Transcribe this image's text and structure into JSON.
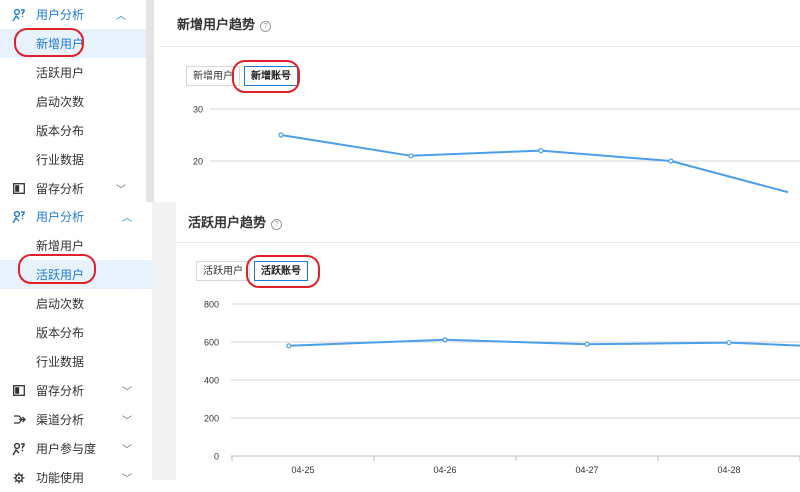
{
  "sidebar_top": {
    "group": {
      "label": "用户分析",
      "icon": "user-analysis-icon",
      "expanded": true
    },
    "items": [
      {
        "label": "新增用户",
        "selected": true
      },
      {
        "label": "活跃用户",
        "selected": false
      },
      {
        "label": "启动次数",
        "selected": false
      },
      {
        "label": "版本分布",
        "selected": false
      },
      {
        "label": "行业数据",
        "selected": false
      }
    ],
    "group2": {
      "label": "留存分析",
      "icon": "retention-icon"
    }
  },
  "sidebar_bottom": {
    "group": {
      "label": "用户分析",
      "icon": "user-analysis-icon",
      "expanded": true
    },
    "items": [
      {
        "label": "新增用户",
        "selected": false
      },
      {
        "label": "活跃用户",
        "selected": true
      },
      {
        "label": "启动次数",
        "selected": false
      },
      {
        "label": "版本分布",
        "selected": false
      },
      {
        "label": "行业数据",
        "selected": false
      }
    ],
    "groups": [
      {
        "label": "留存分析",
        "icon": "retention-icon"
      },
      {
        "label": "渠道分析",
        "icon": "channel-icon"
      },
      {
        "label": "用户参与度",
        "icon": "engagement-icon"
      },
      {
        "label": "功能使用",
        "icon": "feature-icon"
      }
    ]
  },
  "top_panel": {
    "title": "新增用户趋势",
    "tabs": [
      {
        "label": "新增用户",
        "selected": false
      },
      {
        "label": "新增账号",
        "selected": true
      }
    ]
  },
  "bottom_panel": {
    "title": "活跃用户趋势",
    "tabs": [
      {
        "label": "活跃用户",
        "selected": false
      },
      {
        "label": "活跃账号",
        "selected": true
      }
    ]
  },
  "colors": {
    "accent": "#1e7ad6",
    "line": "#4a9eea",
    "highlight_ring": "#e0202a"
  },
  "chart_data": [
    {
      "type": "line",
      "title": "新增用户趋势",
      "yticks": [
        20,
        30
      ],
      "series": [
        {
          "values": [
            {
              "x": 0.3,
              "y": 25
            },
            {
              "x": 1.3,
              "y": 21
            },
            {
              "x": 2.3,
              "y": 22
            },
            {
              "x": 3.3,
              "y": 20
            },
            {
              "x": 4.2,
              "y": 14
            }
          ]
        }
      ]
    },
    {
      "type": "line",
      "title": "活跃用户趋势",
      "categories": [
        "04-25",
        "04-26",
        "04-27",
        "04-28"
      ],
      "yticks": [
        0,
        200,
        400,
        600,
        800
      ],
      "ylim": [
        0,
        800
      ],
      "series": [
        {
          "values": [
            {
              "x": -0.1,
              "y": 580
            },
            {
              "x": 1.0,
              "y": 612
            },
            {
              "x": 2.0,
              "y": 588
            },
            {
              "x": 3.0,
              "y": 597
            },
            {
              "x": 4.0,
              "y": 565
            }
          ]
        }
      ]
    }
  ]
}
